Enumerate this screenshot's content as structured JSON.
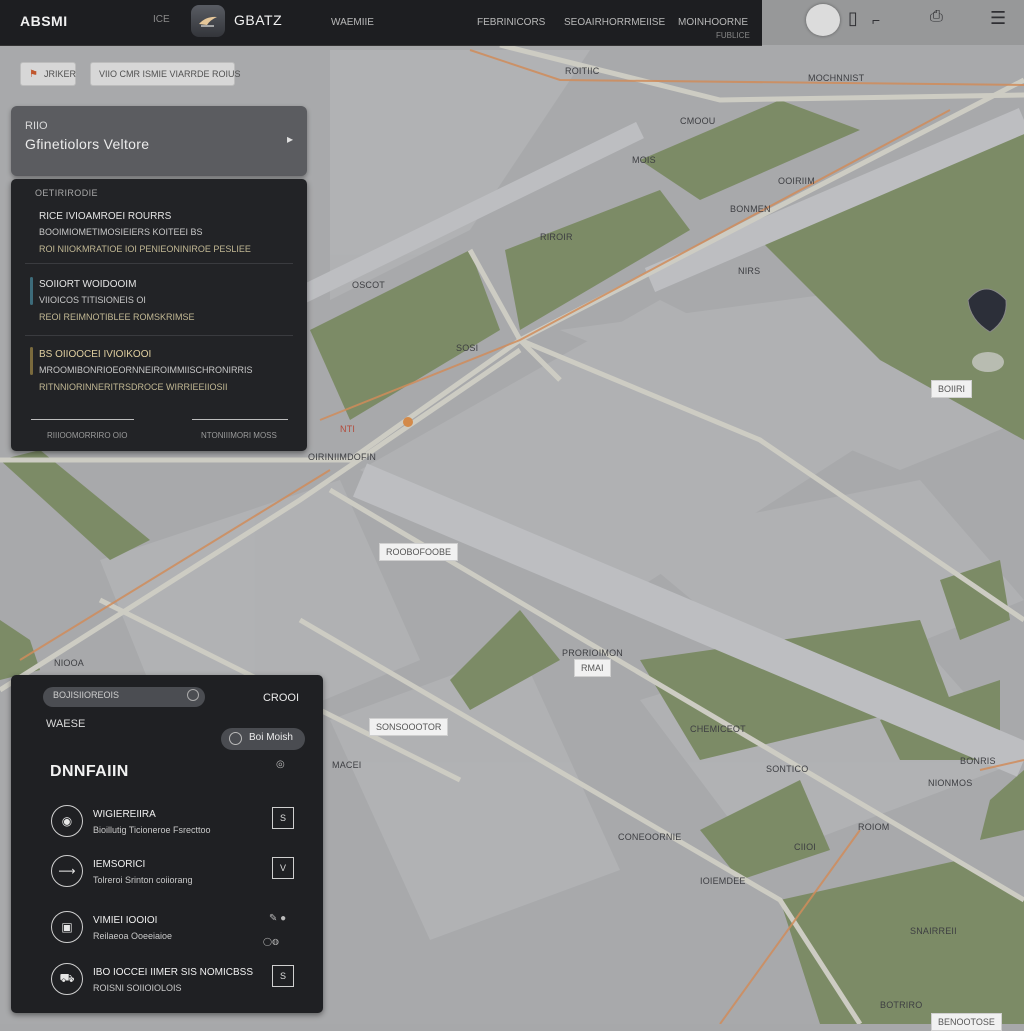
{
  "topbar": {
    "brand": "ABSMI",
    "brand_sub": "ICE",
    "title": "GBATZ",
    "nav": [
      "WAEMIIE",
      "FEBRINICORS",
      "SEOAIRHORRMEIISE",
      "MOINHOORNE"
    ],
    "nav_sub": "FUBLICE"
  },
  "chips": [
    {
      "label": "JRIKER",
      "icon": "flag-icon"
    },
    {
      "label": "VIIO CMR ISMIE VIARRDE ROIUS"
    }
  ],
  "search_card": {
    "label": "RIIO",
    "value": "Gfinetiolors Veltore"
  },
  "results": {
    "header": "OETIRIRODIE",
    "items": [
      {
        "title": "RICE IVIOAMROEI ROURRS",
        "sub": "BOOIMIOMETIMOSIEIERS KOITEEI BS",
        "line": "ROI NIIOKMRATIOE IOI PENIEONINIROE PESLIEE"
      },
      {
        "title": "SOIIORT WOIDOOIM",
        "sub": "VIIOICOS TITISIONEIS OI",
        "line": "REOI REIMNOTIBLEE ROMSKRIMSE"
      },
      {
        "title": "BS OIIOOCEI IVIOIKOOI",
        "sub": "MROOMIBONRIOEORNNEIROIMMIISCHRONIRRIS",
        "line": "RITNNIORINNERITRSDROCE WIRRIEEIIOSII"
      }
    ],
    "foot_left": "RIIIOOMORRIRO OIO",
    "foot_right": "NTONIIIMORI MOSS"
  },
  "detail": {
    "search_placeholder": "BOJISIIOREOIS",
    "right_label": "CROOI",
    "label": "WAESE",
    "pill": "Boi Moish",
    "heading": "DNNFAIIN",
    "rows": [
      {
        "icon": "compass-icon",
        "title": "WIGIEREIIRA",
        "sub": "Bioillutig Ticioneroe Fsrecttoo",
        "tag": "S"
      },
      {
        "icon": "route-icon",
        "title": "IEMSORICI",
        "sub": "Tolreroi Srinton coiiorang",
        "tag": "V"
      },
      {
        "icon": "layers-icon",
        "title": "VIMIEI IOOIOI",
        "sub": "Reilaeoa Ooeeiaioe",
        "tag": ""
      },
      {
        "icon": "car-icon",
        "title": "IBO IOCCEI IIMER SIS NOMICBSS",
        "sub": "ROISNI SOIIOIOLOIS",
        "tag": "S"
      }
    ]
  },
  "map": {
    "labels": [
      "ROITIIC",
      "MOCHNNIST",
      "CMOOU",
      "MOIS",
      "OOIRIIM",
      "BONMEN",
      "RIROIR",
      "OSCOT",
      "SOSI",
      "NTI",
      "OIRINIIMDOFIN",
      "NIOOA",
      "PRORIOIMON",
      "CHEMICEOT",
      "MACEI",
      "SONTICO",
      "NIONMOS",
      "BONRIS",
      "ROIOM",
      "CONEOORNIE",
      "IOIEMDEE",
      "SNAIRREII",
      "CIIOI",
      "BOTRIRO",
      "NIRS"
    ],
    "tags": [
      "BOIIRI",
      "ROOBOFOOBE",
      "RMAI",
      "SONSOOOTOR",
      "BENOOTOSE"
    ],
    "colors": {
      "land": "#a9aaac",
      "park": "#7a8a63",
      "road": "#c9c8c0",
      "highway": "#b2b3b6",
      "arterial": "#cf8a57"
    }
  }
}
